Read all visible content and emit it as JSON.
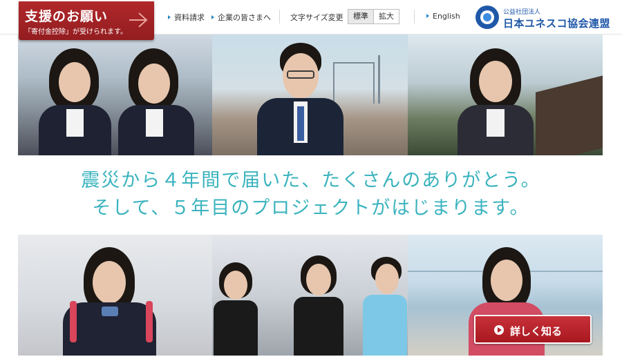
{
  "donate": {
    "title": "支援のお願い",
    "subtitle": "「寄付金控除」が受けられます。"
  },
  "nav": {
    "links": [
      "資料請求",
      "企業の皆さまへ"
    ],
    "font_size_label": "文字サイズ変更",
    "font_size_options": [
      "標準",
      "拡大"
    ],
    "font_size_selected": "標準",
    "english": "English"
  },
  "logo": {
    "top_line": "公益社団法人",
    "main_line": "日本ユネスコ協会連盟"
  },
  "tagline": {
    "line1": "震災から４年間で届いた、たくさんのありがとう。",
    "line2": "そして、５年目のプロジェクトがはじまります。"
  },
  "cta": {
    "label": "詳しく知る"
  },
  "colors": {
    "brand_red": "#a8171f",
    "accent_teal": "#3ab3be",
    "logo_blue": "#1f58a8",
    "nav_triangle": "#2e86c1"
  },
  "icons": [
    "arrow-right-icon",
    "triangle-bullet-icon",
    "play-circle-icon",
    "unesco-logo-icon"
  ]
}
